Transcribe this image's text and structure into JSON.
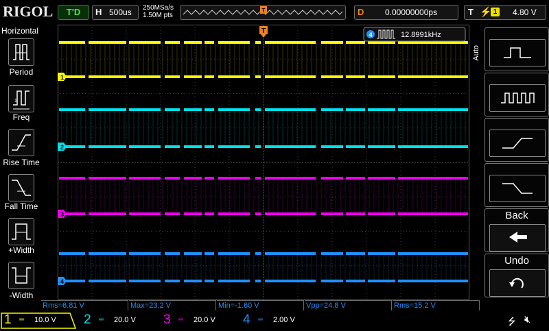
{
  "topbar": {
    "brand": "RIGOL",
    "trigger_status": "T'D",
    "horizontal_key": "H",
    "timebase": "500us",
    "sample_rate": "250MSa/s",
    "memory_depth": "1.50M pts",
    "delay_key": "D",
    "delay_value": "0.00000000ps",
    "trigger_key": "T",
    "trigger_source": "1",
    "trigger_level": "4.80 V"
  },
  "left_menu": {
    "title": "Horizontal",
    "items": [
      {
        "label": "Period",
        "icon": "period-icon"
      },
      {
        "label": "Freq",
        "icon": "freq-icon"
      },
      {
        "label": "Rise Time",
        "icon": "rise-time-icon"
      },
      {
        "label": "Fall Time",
        "icon": "fall-time-icon"
      },
      {
        "label": "+Width",
        "icon": "positive-width-icon"
      },
      {
        "label": "-Width",
        "icon": "negative-width-icon"
      }
    ]
  },
  "counter": {
    "channel": "4",
    "value": "12.8991kHz"
  },
  "right_menu": {
    "mode": "Auto",
    "buttons": [
      {
        "name": "single-pulse",
        "icon": "single-pulse-icon"
      },
      {
        "name": "pulse-train",
        "icon": "pulse-train-icon"
      },
      {
        "name": "rising-edge",
        "icon": "rising-edge-icon"
      },
      {
        "name": "falling-edge",
        "icon": "falling-edge-icon"
      }
    ],
    "back_label": "Back",
    "undo_label": "Undo"
  },
  "measurements": [
    {
      "text": "Rms=6.81 V"
    },
    {
      "text": "Max=23.2 V"
    },
    {
      "text": "Min=-1.60 V"
    },
    {
      "text": "Vpp=24.8 V"
    },
    {
      "text": "Rms=15.2 V"
    }
  ],
  "channels": [
    {
      "num": "1",
      "coupling": "DC",
      "scale": "10.0 V",
      "color": "#f8f800"
    },
    {
      "num": "2",
      "coupling": "DC",
      "scale": "20.0 V",
      "color": "#00e0e8"
    },
    {
      "num": "3",
      "coupling": "DC",
      "scale": "20.0 V",
      "color": "#f000f0"
    },
    {
      "num": "4",
      "coupling": "DC",
      "scale": "2.00 V",
      "color": "#1e90ff"
    }
  ],
  "colors": {
    "ch1": "#f8f800",
    "ch2": "#00e0e8",
    "ch3": "#f000f0",
    "ch4": "#1e90ff",
    "trigger_marker": "#f08020",
    "grid": "#3a3a3a"
  }
}
